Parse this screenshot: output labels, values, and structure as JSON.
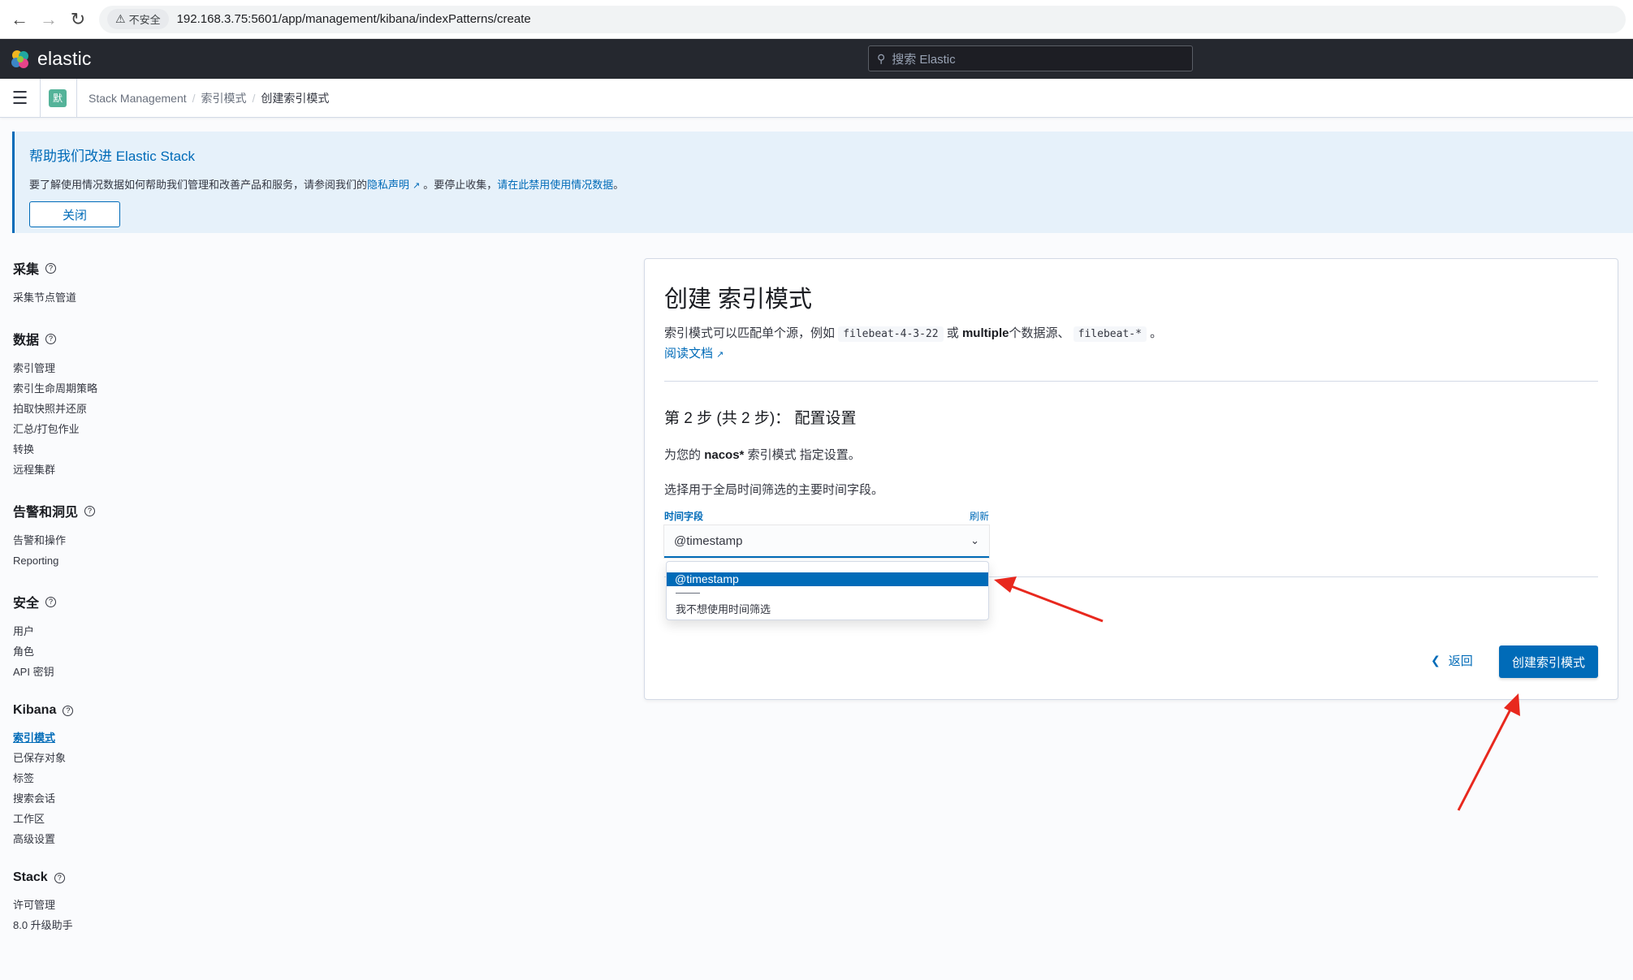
{
  "browser": {
    "security_label": "不安全",
    "url": "192.168.3.75:5601/app/management/kibana/indexPatterns/create"
  },
  "header": {
    "brand": "elastic",
    "search_placeholder": "搜索 Elastic"
  },
  "breadcrumb": {
    "space_initial": "默",
    "items": [
      "Stack Management",
      "索引模式",
      "创建索引模式"
    ]
  },
  "callout": {
    "title": "帮助我们改进 Elastic Stack",
    "text_before": "要了解使用情况数据如何帮助我们管理和改善产品和服务，请参阅我们的",
    "privacy_link": "隐私声明",
    "text_middle": "。要停止收集，",
    "disable_link": "请在此禁用使用情况数据",
    "text_end": "。",
    "close_label": "关闭"
  },
  "sidebar": {
    "groups": [
      {
        "title": "采集",
        "items": [
          "采集节点管道"
        ]
      },
      {
        "title": "数据",
        "items": [
          "索引管理",
          "索引生命周期策略",
          "拍取快照并还原",
          "汇总/打包作业",
          "转换",
          "远程集群"
        ]
      },
      {
        "title": "告警和洞见",
        "items": [
          "告警和操作",
          "Reporting"
        ]
      },
      {
        "title": "安全",
        "items": [
          "用户",
          "角色",
          "API 密钥"
        ]
      },
      {
        "title": "Kibana",
        "items": [
          "索引模式",
          "已保存对象",
          "标签",
          "搜索会话",
          "工作区",
          "高级设置"
        ]
      },
      {
        "title": "Stack",
        "items": [
          "许可管理",
          "8.0 升级助手"
        ]
      }
    ]
  },
  "panel": {
    "title": "创建 索引模式",
    "desc_1": "索引模式可以匹配单个源，例如",
    "code_1": "filebeat-4-3-22",
    "desc_2": "或",
    "desc_bold": "multiple",
    "desc_3": "个数据源、",
    "code_2": "filebeat-*",
    "desc_4": "。",
    "doc_link": "阅读文档",
    "step_title": "第 2 步 (共 2 步)：  配置设置",
    "settings_1": "为您的",
    "settings_bold": "nacos*",
    "settings_2": "索引模式 指定设置。",
    "time_hint": "选择用于全局时间筛选的主要时间字段。",
    "field_label": "时间字段",
    "refresh_label": "刷新",
    "select_value": "@timestamp",
    "options": [
      "@timestamp",
      "我不想使用时间筛选"
    ],
    "back_label": "返回",
    "create_label": "创建索引模式"
  },
  "colors": {
    "primary": "#006bb8",
    "header_bg": "#25282f",
    "annotation": "#e8281e"
  }
}
